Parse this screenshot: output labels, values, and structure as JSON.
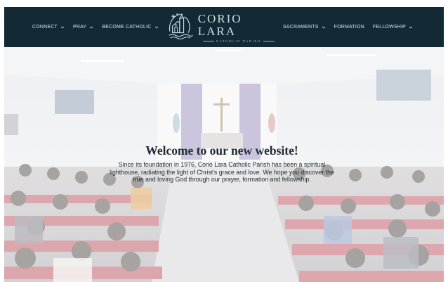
{
  "nav": {
    "left_items": [
      {
        "label": "CONNECT",
        "has_dropdown": true
      },
      {
        "label": "PRAY",
        "has_dropdown": true
      },
      {
        "label": "BECOME CATHOLIC",
        "has_dropdown": true
      }
    ],
    "right_items": [
      {
        "label": "SACRAMENTS",
        "has_dropdown": true
      },
      {
        "label": "FORMATION",
        "has_dropdown": false
      },
      {
        "label": "FELLOWSHIP",
        "has_dropdown": true
      }
    ],
    "logo_title": "CORIO LARA",
    "logo_subtitle": "CATHOLIC PARISH"
  },
  "hero": {
    "heading": "Welcome to our new website!",
    "body": "Since its foundation in 1976, Corio Lara Catholic Parish has been a spiritual lighthouse, radiating the light of Christ's grace and love. We hope you discover the true and loving God through our prayer, formation and fellowship."
  },
  "colors": {
    "navbar_bg": "#132a36",
    "nav_text": "#d7e6ea",
    "logo_text": "#c9dfe3",
    "heading_text": "#1e2a33"
  },
  "icons": {
    "dropdown": "chevron-down-icon",
    "logo": "church-lighthouse-logo-icon"
  }
}
